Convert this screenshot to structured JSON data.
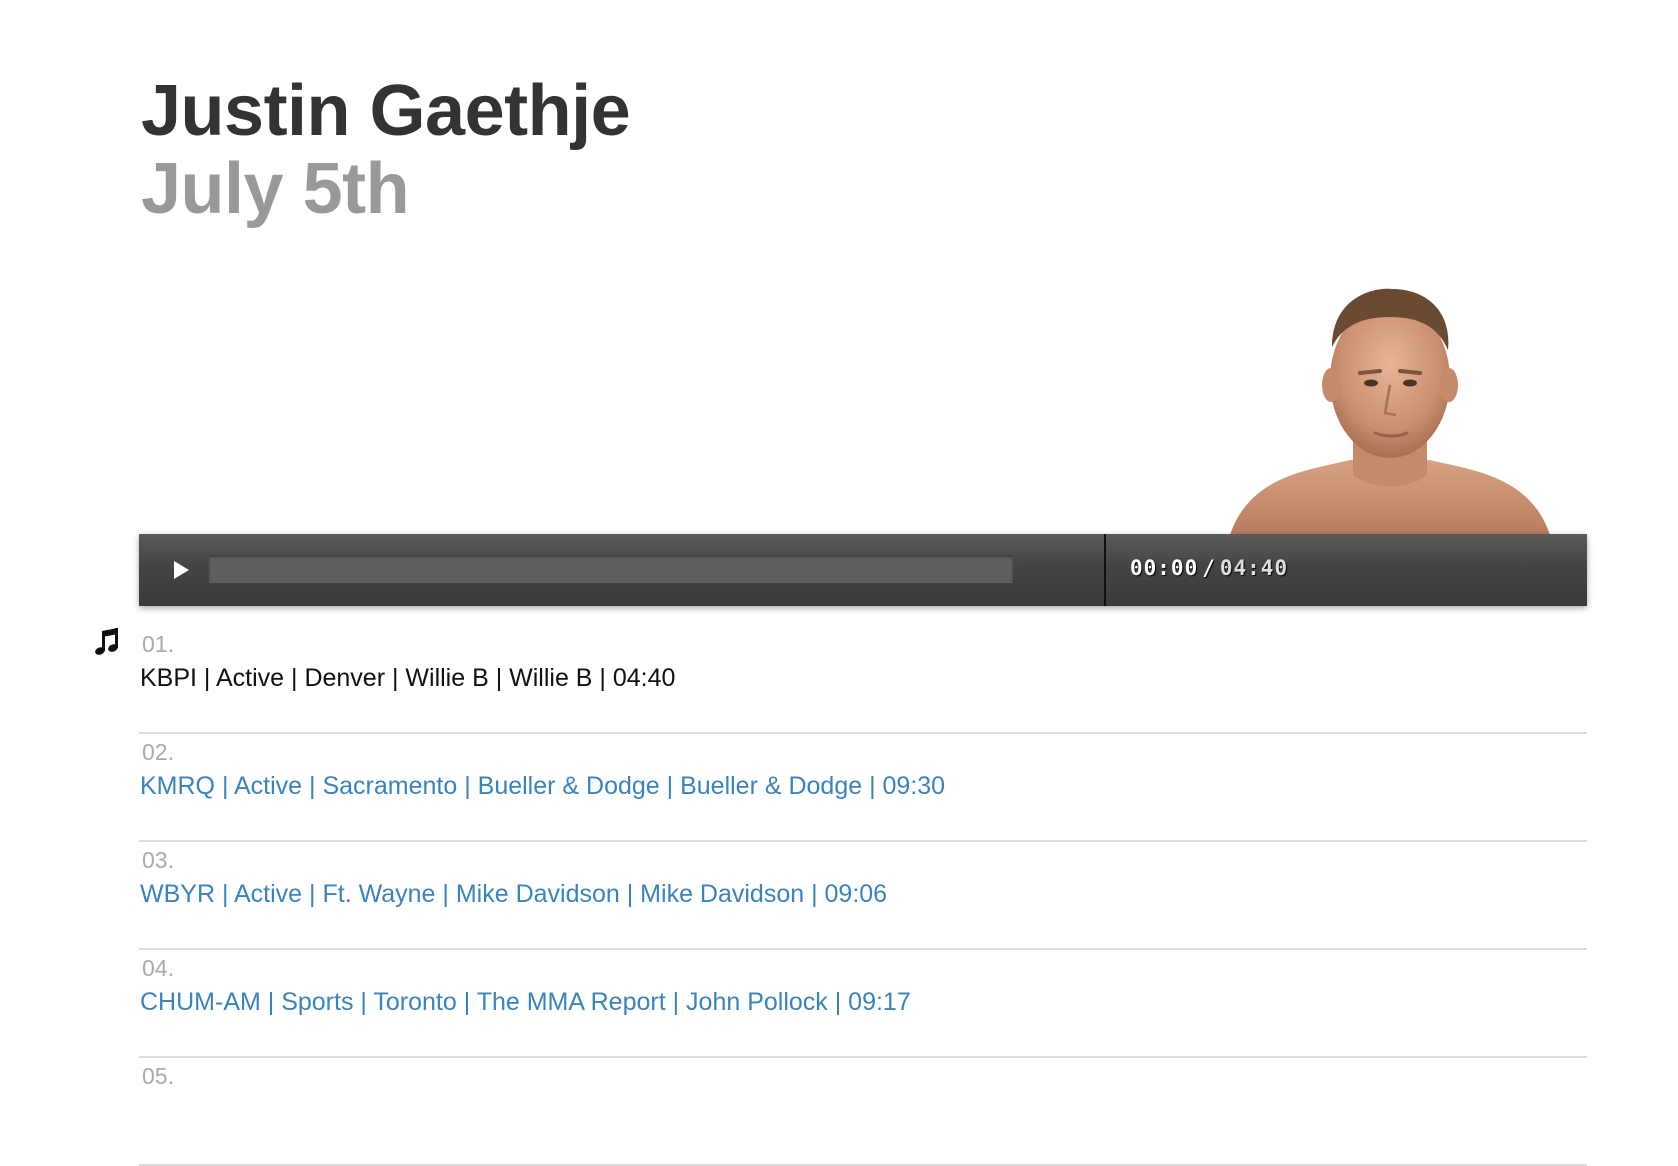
{
  "header": {
    "title": "Justin Gaethje",
    "subtitle": "July 5th"
  },
  "player": {
    "current_time": "00:00",
    "separator": "/",
    "duration": "04:40",
    "progress": 0
  },
  "playlist": [
    {
      "number": "01.",
      "title": "KBPI | Active | Denver | Willie B | Willie B | 04:40",
      "current": true
    },
    {
      "number": "02.",
      "title": "KMRQ | Active | Sacramento | Bueller & Dodge | Bueller & Dodge | 09:30"
    },
    {
      "number": "03.",
      "title": "WBYR | Active | Ft. Wayne | Mike Davidson | Mike Davidson | 09:06"
    },
    {
      "number": "04.",
      "title": "CHUM-AM | Sports | Toronto | The MMA Report | John Pollock | 09:17"
    },
    {
      "number": "05.",
      "title": ""
    }
  ],
  "icons": {
    "now_playing": "music-note-icon",
    "play": "play-icon"
  },
  "colors": {
    "link": "#3a84bd",
    "current_track": "#111111",
    "title": "#333333",
    "subtitle": "#999999",
    "player_bar": "#444444"
  }
}
